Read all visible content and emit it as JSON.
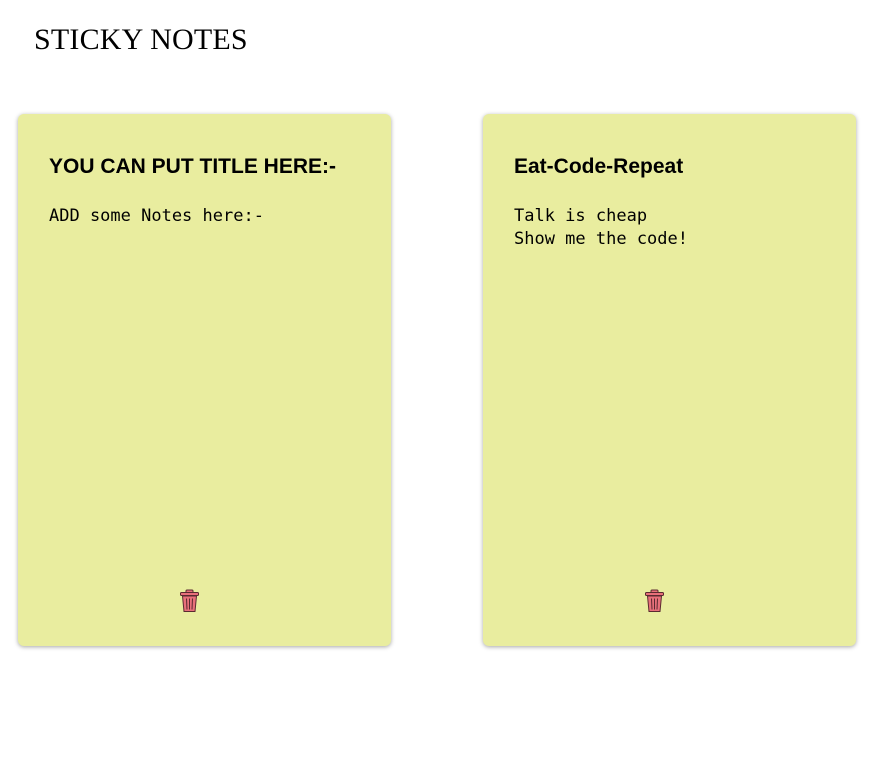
{
  "header": {
    "title": "STICKY NOTES"
  },
  "notes": [
    {
      "title": "YOU CAN PUT TITLE HERE:-",
      "body": "ADD some Notes here:-",
      "delete_icon": "trash-icon"
    },
    {
      "title": "Eat-Code-Repeat",
      "body": "Talk is cheap\nShow me the code!",
      "delete_icon": "trash-icon"
    }
  ],
  "colors": {
    "note_background": "#e9ed9f",
    "trash_fill": "#e8707a",
    "trash_stroke": "#5a2a30"
  }
}
